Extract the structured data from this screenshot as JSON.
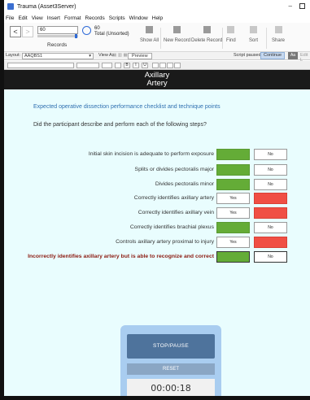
{
  "window": {
    "title": "Trauma (Asset3Server)",
    "minimize": "–"
  },
  "menu": [
    "File",
    "Edit",
    "View",
    "Insert",
    "Format",
    "Records",
    "Scripts",
    "Window",
    "Help"
  ],
  "toolbar": {
    "back": "<",
    "forward": ">",
    "record_number": "60",
    "records_label": "Records",
    "record_count": "60",
    "record_total": "Total (Unsorted)",
    "show_all": "Show All",
    "new_record": "New Record",
    "delete_record": "Delete Record",
    "find": "Find",
    "sort": "Sort",
    "share": "Share"
  },
  "layoutbar": {
    "layout_label": "Layout:",
    "layout_value": "AAQBS1",
    "view_as": "View As:",
    "preview": "Preview",
    "script_paused": "Script paused",
    "continue": "Continue",
    "aa": "Aa",
    "edit_layout": "Edit L"
  },
  "formatbar": {
    "bold": "B",
    "italic": "I",
    "underline": "U"
  },
  "header": {
    "line1": "Axillary",
    "line2": "Artery"
  },
  "content": {
    "intro": "Expected operative dissection performance checklist and technique points",
    "question": "Did the participant describe and perform each of the following steps?"
  },
  "checklist": [
    {
      "label": "Initial skin incision is adequate to perform exposure",
      "yes": "",
      "no": "No",
      "yes_color": "green",
      "no_color": "white",
      "warn": false
    },
    {
      "label": "Splits or divides pectoralis major",
      "yes": "",
      "no": "No",
      "yes_color": "green",
      "no_color": "white",
      "warn": false
    },
    {
      "label": "Divides pectoralis minor",
      "yes": "",
      "no": "No",
      "yes_color": "green",
      "no_color": "white",
      "warn": false
    },
    {
      "label": "Correctly identifies axillary artery",
      "yes": "Yes",
      "no": "",
      "yes_color": "white",
      "no_color": "red",
      "warn": false
    },
    {
      "label": "Correctly identifies axillary vein",
      "yes": "Yes",
      "no": "",
      "yes_color": "white",
      "no_color": "red",
      "warn": false
    },
    {
      "label": "Correctly identifies brachial plexus",
      "yes": "",
      "no": "No",
      "yes_color": "green",
      "no_color": "white",
      "warn": false
    },
    {
      "label": "Controls axillary artery proximal to injury",
      "yes": "Yes",
      "no": "",
      "yes_color": "white",
      "no_color": "red",
      "warn": false
    },
    {
      "label": "Incorrectly identifies axillary artery but is able to recognize and correct",
      "yes": "",
      "no": "No",
      "yes_color": "green",
      "no_color": "white",
      "warn": true
    }
  ],
  "timer": {
    "stop_pause": "STOP/PAUSE",
    "reset": "RESET",
    "time": "00:00:18"
  },
  "colors": {
    "accent": "#2f6bd8",
    "yes_green": "#64ac37",
    "no_red": "#f04f44",
    "content_bg": "#e9fdfe",
    "header_bg": "#1a1a1a"
  }
}
